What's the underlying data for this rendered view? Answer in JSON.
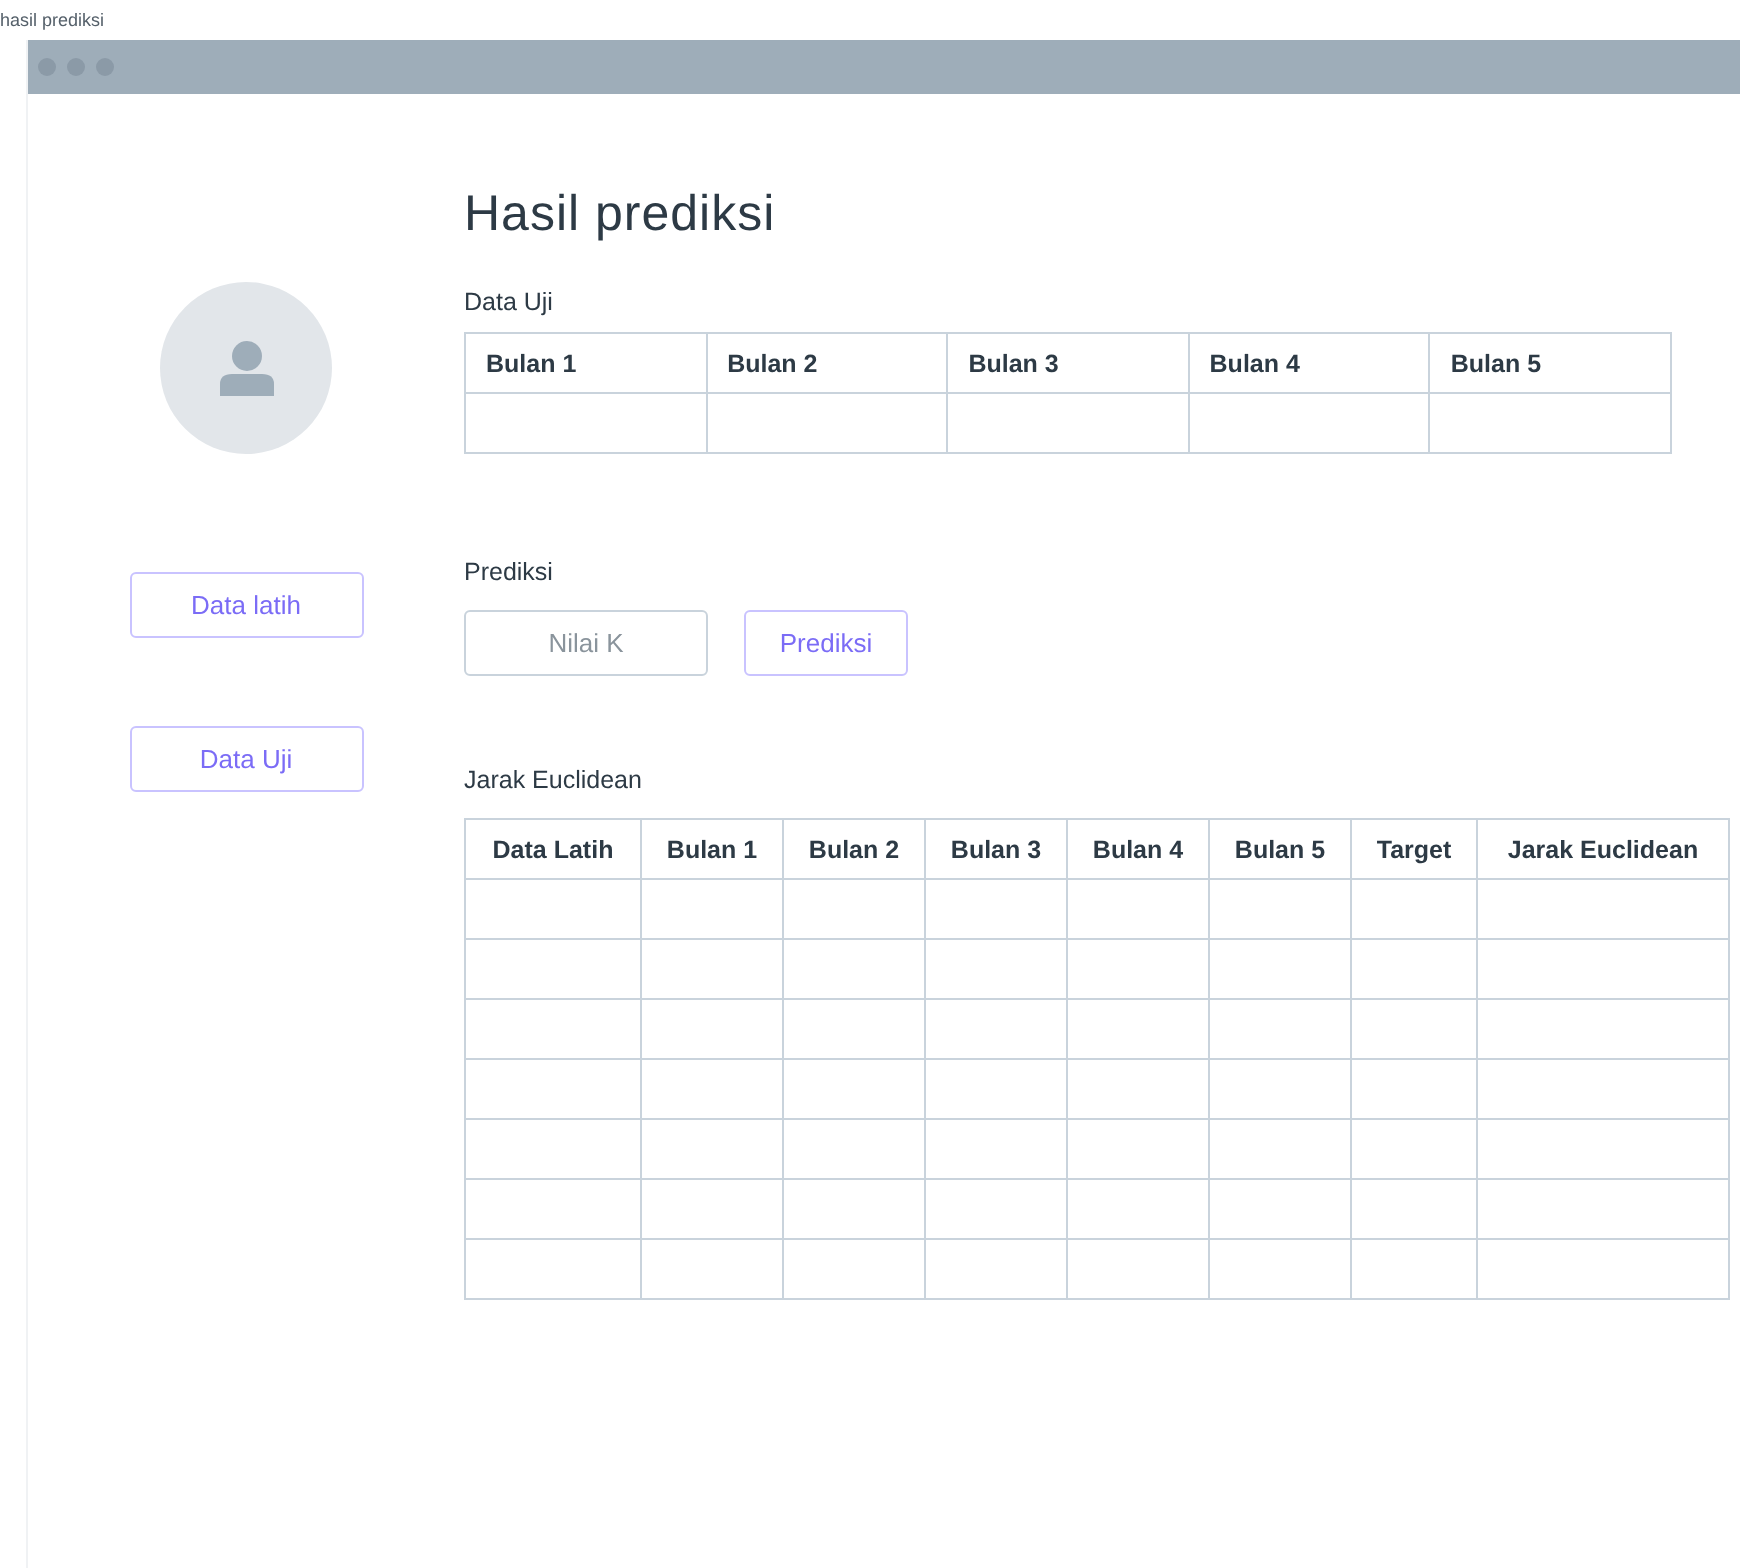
{
  "page_label": "hasil prediksi",
  "sidebar": {
    "buttons": [
      "Data latih",
      "Data Uji"
    ]
  },
  "title": "Hasil prediksi",
  "test_data": {
    "label": "Data Uji",
    "columns": [
      "Bulan 1",
      "Bulan 2",
      "Bulan 3",
      "Bulan 4",
      "Bulan 5"
    ]
  },
  "prediction": {
    "label": "Prediksi",
    "k_field": {
      "placeholder": "Nilai K"
    },
    "button": "Prediksi"
  },
  "distance": {
    "label": "Jarak Euclidean",
    "columns": [
      "Data Latih",
      "Bulan 1",
      "Bulan 2",
      "Bulan 3",
      "Bulan 4",
      "Bulan 5",
      "Target",
      "Jarak Euclidean"
    ]
  }
}
